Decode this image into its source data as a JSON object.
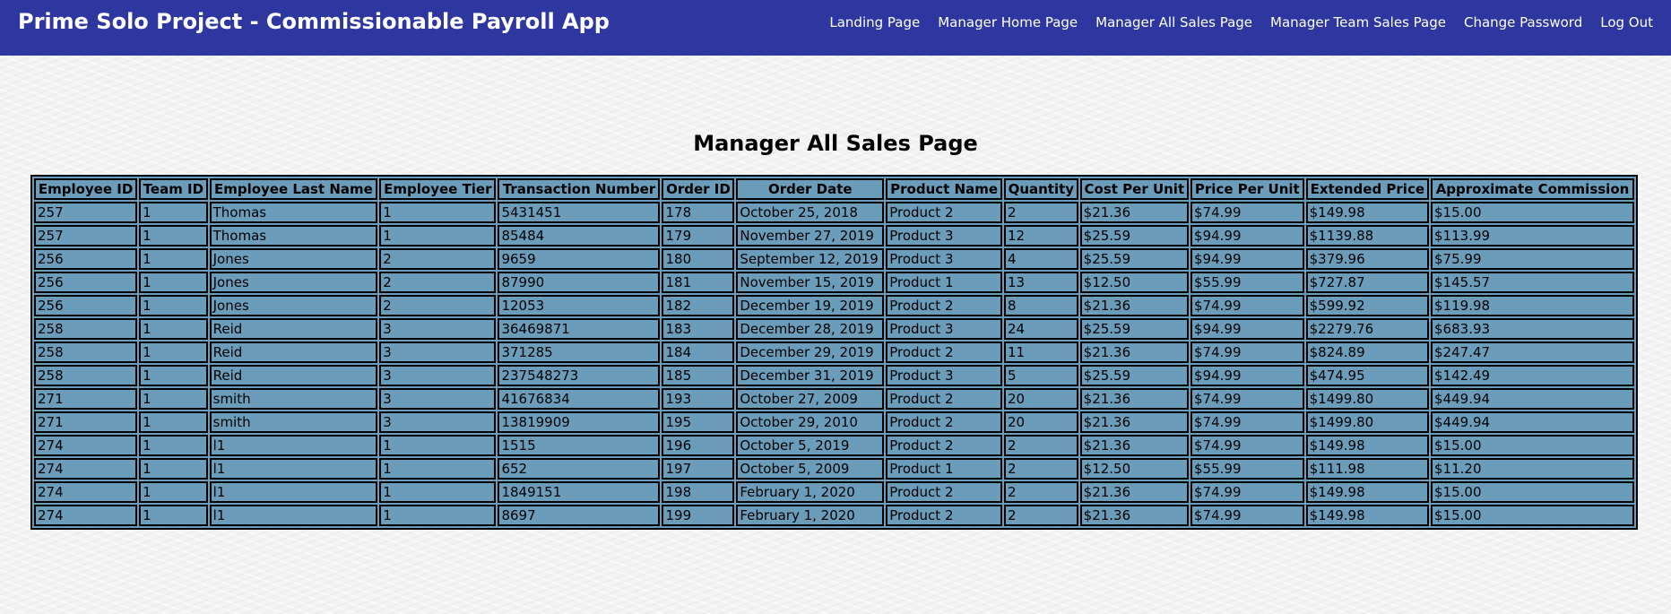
{
  "app": {
    "title": "Prime Solo Project - Commissionable Payroll App"
  },
  "nav": {
    "links": [
      "Landing Page",
      "Manager Home Page",
      "Manager All Sales Page",
      "Manager Team Sales Page",
      "Change Password",
      "Log Out"
    ]
  },
  "page": {
    "title": "Manager All Sales Page"
  },
  "table": {
    "headers": [
      "Employee ID",
      "Team ID",
      "Employee Last Name",
      "Employee Tier",
      "Transaction Number",
      "Order ID",
      "Order Date",
      "Product Name",
      "Quantity",
      "Cost Per Unit",
      "Price Per Unit",
      "Extended Price",
      "Approximate Commission"
    ],
    "rows": [
      [
        "257",
        "1",
        "Thomas",
        "1",
        "5431451",
        "178",
        "October 25, 2018",
        "Product 2",
        "2",
        "$21.36",
        "$74.99",
        "$149.98",
        "$15.00"
      ],
      [
        "257",
        "1",
        "Thomas",
        "1",
        "85484",
        "179",
        "November 27, 2019",
        "Product 3",
        "12",
        "$25.59",
        "$94.99",
        "$1139.88",
        "$113.99"
      ],
      [
        "256",
        "1",
        "Jones",
        "2",
        "9659",
        "180",
        "September 12, 2019",
        "Product 3",
        "4",
        "$25.59",
        "$94.99",
        "$379.96",
        "$75.99"
      ],
      [
        "256",
        "1",
        "Jones",
        "2",
        "87990",
        "181",
        "November 15, 2019",
        "Product 1",
        "13",
        "$12.50",
        "$55.99",
        "$727.87",
        "$145.57"
      ],
      [
        "256",
        "1",
        "Jones",
        "2",
        "12053",
        "182",
        "December 19, 2019",
        "Product 2",
        "8",
        "$21.36",
        "$74.99",
        "$599.92",
        "$119.98"
      ],
      [
        "258",
        "1",
        "Reid",
        "3",
        "36469871",
        "183",
        "December 28, 2019",
        "Product 3",
        "24",
        "$25.59",
        "$94.99",
        "$2279.76",
        "$683.93"
      ],
      [
        "258",
        "1",
        "Reid",
        "3",
        "371285",
        "184",
        "December 29, 2019",
        "Product 2",
        "11",
        "$21.36",
        "$74.99",
        "$824.89",
        "$247.47"
      ],
      [
        "258",
        "1",
        "Reid",
        "3",
        "237548273",
        "185",
        "December 31, 2019",
        "Product 3",
        "5",
        "$25.59",
        "$94.99",
        "$474.95",
        "$142.49"
      ],
      [
        "271",
        "1",
        "smith",
        "3",
        "41676834",
        "193",
        "October 27, 2009",
        "Product 2",
        "20",
        "$21.36",
        "$74.99",
        "$1499.80",
        "$449.94"
      ],
      [
        "271",
        "1",
        "smith",
        "3",
        "13819909",
        "195",
        "October 29, 2010",
        "Product 2",
        "20",
        "$21.36",
        "$74.99",
        "$1499.80",
        "$449.94"
      ],
      [
        "274",
        "1",
        "l1",
        "1",
        "1515",
        "196",
        "October 5, 2019",
        "Product 2",
        "2",
        "$21.36",
        "$74.99",
        "$149.98",
        "$15.00"
      ],
      [
        "274",
        "1",
        "l1",
        "1",
        "652",
        "197",
        "October 5, 2009",
        "Product 1",
        "2",
        "$12.50",
        "$55.99",
        "$111.98",
        "$11.20"
      ],
      [
        "274",
        "1",
        "l1",
        "1",
        "1849151",
        "198",
        "February 1, 2020",
        "Product 2",
        "2",
        "$21.36",
        "$74.99",
        "$149.98",
        "$15.00"
      ],
      [
        "274",
        "1",
        "l1",
        "1",
        "8697",
        "199",
        "February 1, 2020",
        "Product 2",
        "2",
        "$21.36",
        "$74.99",
        "$149.98",
        "$15.00"
      ]
    ]
  },
  "colors": {
    "nav_background": "#2e37a0",
    "table_background": "#6b9dbb"
  }
}
